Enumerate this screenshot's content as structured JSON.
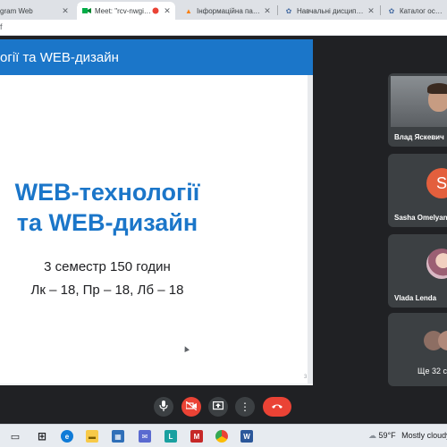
{
  "browser": {
    "tabs": [
      {
        "label": "gram Web",
        "icon": "telegram-icon",
        "active": false
      },
      {
        "label": "Meet: \"rcv-nwgi-qm",
        "icon": "meet-icon",
        "active": true
      },
      {
        "label": "Інформаційна панель",
        "icon": "moodle-icon",
        "active": false
      },
      {
        "label": "Навчальні дисципліни",
        "icon": "university-icon",
        "active": false
      },
      {
        "label": "Каталог освітніх",
        "icon": "university-icon",
        "active": false
      }
    ],
    "address_fragment": "f"
  },
  "slide": {
    "header": "огії та WEB-дизайн",
    "title_line1": "WEB-технології",
    "title_line2": "та WEB-дизайн",
    "subtitle1": "3 семестр 150 годин",
    "subtitle2": "Лк – 18, Пр – 18, Лб – 18",
    "page_number": "3"
  },
  "participants": [
    {
      "name": "Влад Яскевич"
    },
    {
      "name": "Sasha Omelyan",
      "initial": "S"
    },
    {
      "name": "Vlada Lenda"
    },
    {
      "name": "Ще 32 с"
    }
  ],
  "weather": {
    "temp": "59°F",
    "condition": "Mostly cloudy"
  },
  "colors": {
    "accent_blue": "#1b76c9",
    "meet_bg": "#202124",
    "hangup_red": "#ea4335",
    "avatar_orange": "#e35f3d"
  }
}
